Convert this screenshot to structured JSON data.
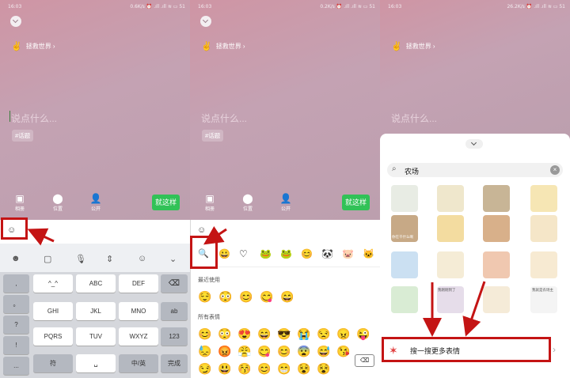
{
  "common": {
    "status_time": "16:03",
    "world_label": "拯救世界 ›",
    "placeholder": "说点什么...",
    "topic": "#话题",
    "tools": [
      "相册",
      "位置",
      "公开"
    ],
    "submit_label": "就这样"
  },
  "panel1": {
    "status_right": "0.6K/s ⏰ .ıll .ıll ≋ ▭ 51",
    "toolbar_icons": [
      "emoji-face-icon",
      "clipboard-icon",
      "mic-icon",
      "cursor-move-icon",
      "smile-icon",
      "chevron-down-icon"
    ],
    "keyboard": {
      "left_col": [
        ",",
        "。",
        "?",
        "!",
        "..."
      ],
      "rows": [
        [
          "^_^",
          "ABC",
          "DEF"
        ],
        [
          "GHI",
          "JKL",
          "MNO"
        ],
        [
          "PQRS",
          "TUV",
          "WXYZ"
        ]
      ],
      "right_col": [
        "⌫",
        "ab",
        "123",
        "完成"
      ],
      "bottom_row": [
        "符",
        "␣",
        "中/英"
      ]
    }
  },
  "panel2": {
    "status_right": "0.2K/s ⏰ .ıll .ıll ≋ ▭ 51",
    "recent_label": "最近使用",
    "all_label": "所有表情",
    "category_icons": [
      "🔍",
      "😀",
      "♡",
      "🐸",
      "🐸",
      "😊",
      "🐼",
      "🐷",
      "🐱"
    ],
    "recent": [
      "😌",
      "😳",
      "😊",
      "😋",
      "😄"
    ],
    "all_rows": [
      [
        "😊",
        "😳",
        "😍",
        "😄",
        "😎",
        "😭",
        "😒",
        "😠",
        "😜"
      ],
      [
        "😓",
        "😡",
        "😤",
        "😋",
        "😊",
        "😨",
        "😅",
        "😘",
        ""
      ],
      [
        "😏",
        "😃",
        "😚",
        "😊",
        "😁",
        "😵",
        "😵",
        "",
        ""
      ]
    ],
    "delete_label": "⌫"
  },
  "panel3": {
    "status_right": "26.2K/s ⏰ .ıll .ıll ≋ ▭ 51",
    "search_value": "农场",
    "search_more_label": "搜一搜更多表情",
    "sticker_captions": [
      "你在干什么啊",
      "我刚刚到了",
      "我就是农场主"
    ]
  }
}
